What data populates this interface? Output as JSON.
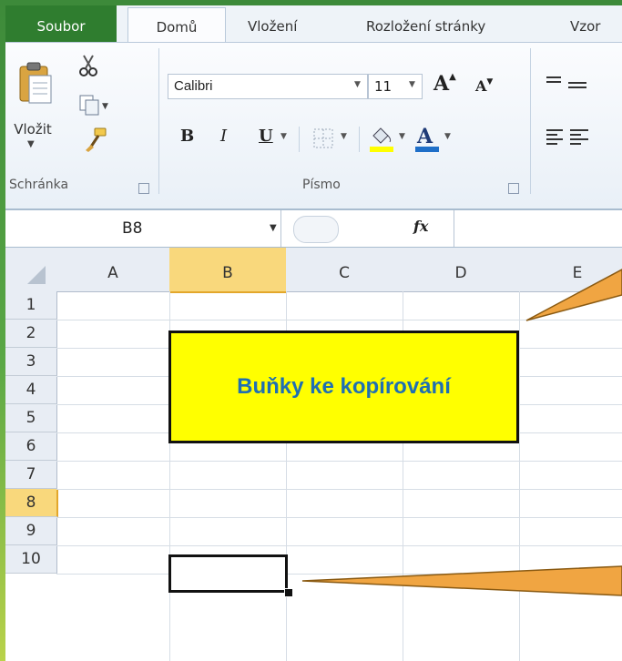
{
  "ribbon": {
    "tabs": [
      {
        "label": "Soubor"
      },
      {
        "label": "Domů"
      },
      {
        "label": "Vložení"
      },
      {
        "label": "Rozložení stránky"
      },
      {
        "label": "Vzor"
      }
    ],
    "clipboard": {
      "paste_label": "Vložit",
      "group_label": "Schránka"
    },
    "font": {
      "name": "Calibri",
      "size": "11",
      "bold": "B",
      "italic": "I",
      "underline": "U",
      "group_label": "Písmo"
    }
  },
  "formula_bar": {
    "name_box": "B8",
    "fx": "fx",
    "value": ""
  },
  "grid": {
    "columns": [
      "A",
      "B",
      "C",
      "D",
      "E"
    ],
    "rows": [
      "1",
      "2",
      "3",
      "4",
      "5",
      "6",
      "7",
      "8",
      "9",
      "10"
    ],
    "selected_cell": "B8",
    "callout_text": "Buňky ke kopírování"
  },
  "colors": {
    "file_tab": "#2f7d2f",
    "callout_fill": "#ffff00",
    "callout_text": "#1f6fb2",
    "pointer_orange": "#f0a542",
    "selected_header": "#f9d87c"
  }
}
